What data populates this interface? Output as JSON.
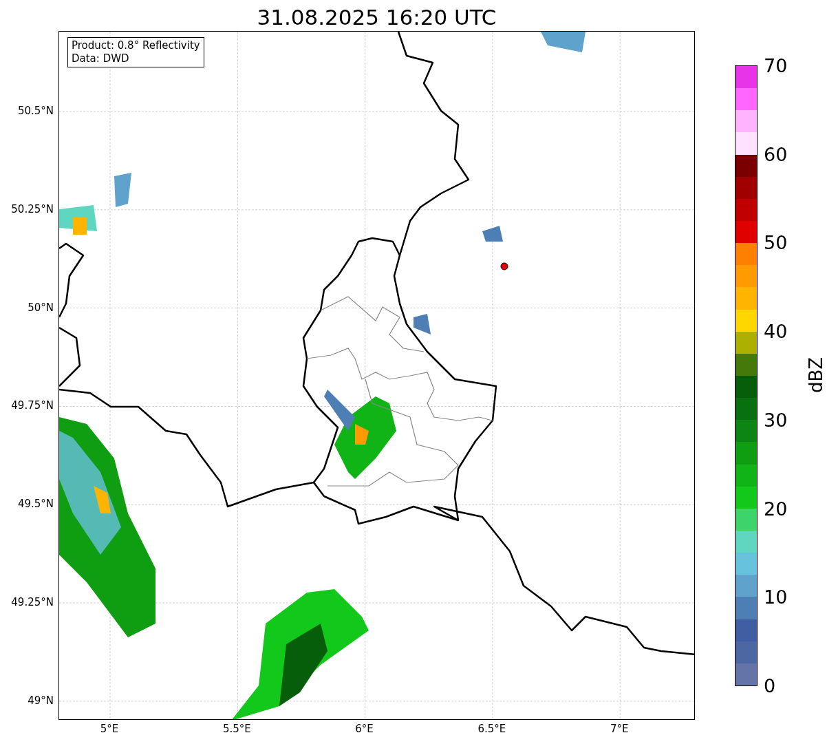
{
  "title": "31.08.2025 16:20 UTC",
  "info_box": [
    "Product: 0.8° Reflectivity",
    "Data: DWD"
  ],
  "y_ticks": [
    "50.5°N",
    "50.25°N",
    "50°N",
    "49.75°N",
    "49.5°N",
    "49.25°N",
    "49°N"
  ],
  "x_ticks": [
    "5°E",
    "5.5°E",
    "6°E",
    "6.5°E",
    "7°E"
  ],
  "colorbar": {
    "label": "dBZ",
    "ticks": [
      "70",
      "60",
      "50",
      "40",
      "30",
      "20",
      "10",
      "0"
    ],
    "bands": [
      {
        "color": "#6474a8"
      },
      {
        "color": "#4d67a3"
      },
      {
        "color": "#405ea3"
      },
      {
        "color": "#4d7fb5"
      },
      {
        "color": "#5fa3cc"
      },
      {
        "color": "#67c2dd"
      },
      {
        "color": "#5fd6c0"
      },
      {
        "color": "#3dd56b"
      },
      {
        "color": "#12c81a"
      },
      {
        "color": "#10b416"
      },
      {
        "color": "#0f9d12"
      },
      {
        "color": "#0c8514"
      },
      {
        "color": "#097010"
      },
      {
        "color": "#075e0a"
      },
      {
        "color": "#457a0b"
      },
      {
        "color": "#adb000"
      },
      {
        "color": "#ffd700"
      },
      {
        "color": "#ffb500"
      },
      {
        "color": "#ff9a00"
      },
      {
        "color": "#ff7f00"
      },
      {
        "color": "#e00000"
      },
      {
        "color": "#c00000"
      },
      {
        "color": "#a00000"
      },
      {
        "color": "#7a0000"
      },
      {
        "color": "#ffe0ff"
      },
      {
        "color": "#ffb3ff"
      },
      {
        "color": "#ff66ff"
      },
      {
        "color": "#e833e8"
      }
    ]
  }
}
